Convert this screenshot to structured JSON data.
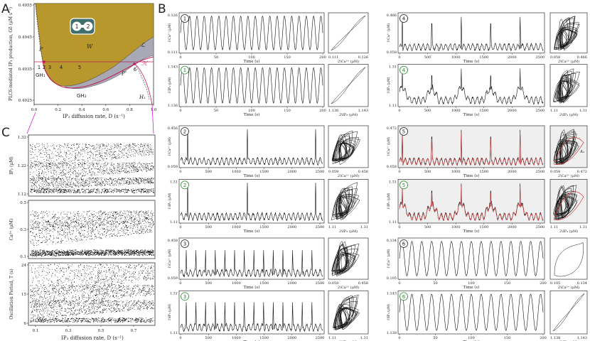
{
  "panel_labels": {
    "A": "A",
    "B": "B",
    "C": "C"
  },
  "panelA": {
    "ylabel": "PLCδ-mediated IP₃ production, Gδ (μM s⁻¹)",
    "xlabel": "IP₃ diffusion rate, D (s⁻¹)",
    "yticks": [
      "0.4955",
      "0.4945",
      "0.4935",
      "0.4925"
    ],
    "xticks": [
      "0.0",
      "0.2",
      "0.4",
      "0.6",
      "0.8",
      "1.0"
    ],
    "cell_labels": [
      "1",
      "2"
    ],
    "region_labels": {
      "W": "W",
      "L": "ℒ",
      "H": "ℋ",
      "Pp": "P′",
      "Ppp": "P″",
      "GH1": "GH₁",
      "GH2": "GH₂",
      "H1": "H₁"
    },
    "point_labels": [
      "1",
      "2",
      "3",
      "4",
      "5",
      "6"
    ],
    "colors": {
      "region_fill": "#b8972c",
      "bistable_fill": "#a9a9b5",
      "hopf_line": "#c2185b",
      "gh_dot": "#c2185b"
    }
  },
  "panelC": {
    "ylabels": [
      "IP₃ (μM)",
      "Ca²⁺ (μM)",
      "Oscillation Period, T (s)"
    ],
    "yticks": [
      [
        "1.32",
        "1.22",
        "1.12"
      ],
      [
        "0.5",
        "0.3",
        "0.1"
      ],
      [
        "24",
        "15",
        "6"
      ]
    ],
    "xlabel": "IP₃ diffusion rate, D (s⁻¹)",
    "xticks": [
      "0.1",
      "0.3",
      "0.5",
      "0.7"
    ]
  },
  "panelB": {
    "cells": [
      {
        "num": "1",
        "ca_ylim": [
          "0.126",
          "0.111"
        ],
        "ip3_ylim": [
          "1.143",
          "1.136"
        ],
        "time_ticks": [
          "0",
          "50",
          "100",
          "150",
          "200"
        ],
        "time_label": "Time (s)",
        "ca_ticks": [
          "0.111",
          "0.126"
        ],
        "ip3_ticks": [
          "1.136",
          "1.143"
        ]
      },
      {
        "num": "2",
        "ca_ylim": [
          "0.456",
          "0.059"
        ],
        "ip3_ylim": [
          "1.31",
          "1.11"
        ],
        "time_ticks": [
          "0",
          "500",
          "1000",
          "1500",
          "2000",
          "2500"
        ],
        "time_label": "Time (s)",
        "ca_ticks": [
          "0.059",
          "0.456"
        ],
        "ip3_ticks": [
          "1.11",
          "1.31"
        ]
      },
      {
        "num": "3",
        "ca_ylim": [
          "0.458",
          "0.059"
        ],
        "ip3_ylim": [
          "1.31",
          "1.11"
        ],
        "time_ticks": [
          "0",
          "500",
          "1000",
          "1500",
          "2000",
          "2500"
        ],
        "time_label": "Time (s)",
        "ca_ticks": [
          "0.059",
          "0.458"
        ],
        "ip3_ticks": [
          "1.11",
          "1.31"
        ]
      },
      {
        "num": "4",
        "ca_ylim": [
          "0.466",
          "0.058"
        ],
        "ip3_ylim": [
          "1.31",
          "1.11"
        ],
        "time_ticks": [
          "0",
          "500",
          "1000",
          "1500",
          "2000",
          "2500"
        ],
        "time_label": "Time (s)",
        "ca_ticks": [
          "0.058",
          "0.466"
        ],
        "ip3_ticks": [
          "1.11",
          "1.31"
        ]
      },
      {
        "num": "5",
        "ca_ylim": [
          "0.472",
          "0.058"
        ],
        "ip3_ylim": [
          "1.31",
          "1.11"
        ],
        "time_ticks": [
          "0",
          "500",
          "1000",
          "1500",
          "2000",
          "2500"
        ],
        "time_label": "Time (s)",
        "ca_ticks": [
          "0.058",
          "0.472"
        ],
        "ip3_ticks": [
          "1.11",
          "1.31"
        ]
      },
      {
        "num": "6",
        "ca_ylim": [
          "0.134",
          "0.105"
        ],
        "ip3_ylim": [
          "1.143",
          "1.138"
        ],
        "time_ticks": [
          "0",
          "50",
          "100",
          "150",
          "200"
        ],
        "time_label": "Time (s)",
        "ca_ticks": [
          "0.105",
          "0.134"
        ],
        "ip3_ticks": [
          "1.138",
          "1.143"
        ]
      }
    ],
    "ylabels": {
      "ca": "1\\Ca²⁺ (μM)",
      "ip3": "1\\IP₃ (μM)"
    },
    "xlabels": {
      "ca": "2\\Ca²⁺ (μM)",
      "ip3": "2\\IP₃ (μM)"
    },
    "annotations": {
      "A1": "A₁",
      "A2": "A₂"
    },
    "colors": {
      "trace": "#111111",
      "red_trace": "#d23c3c",
      "shade": "#efefef",
      "label_green": "#2e8b2e"
    }
  }
}
